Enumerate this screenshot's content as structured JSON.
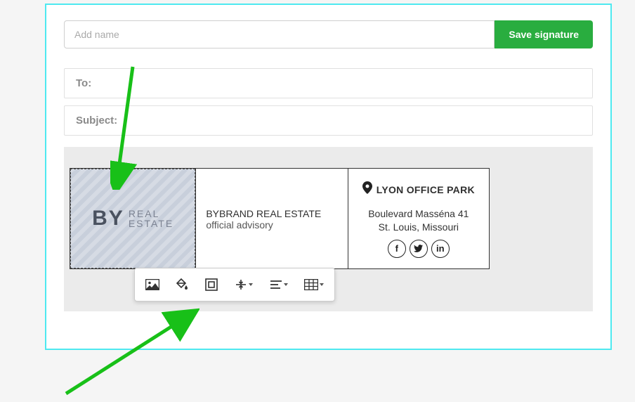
{
  "form": {
    "name_placeholder": "Add name",
    "save_label": "Save signature",
    "to_label": "To:",
    "subject_label": "Subject:"
  },
  "signature": {
    "logo_by": "BY",
    "logo_line1": "REAL",
    "logo_line2": "ESTATE",
    "company": "BYBRAND REAL ESTATE",
    "tagline": "official advisory",
    "office_title": "LYON OFFICE PARK",
    "addr_line1": "Boulevard Masséna 41",
    "addr_line2": "St. Louis, Missouri"
  }
}
